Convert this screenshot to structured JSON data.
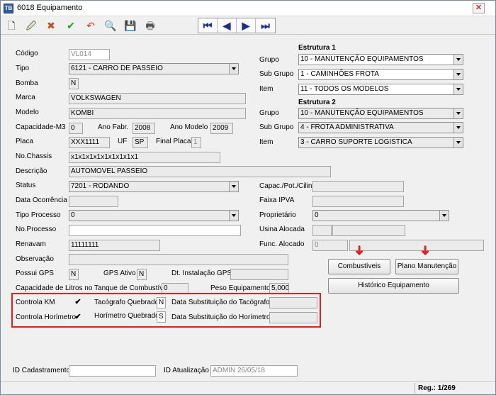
{
  "window": {
    "title": "6018 Equipamento",
    "app_icon_text": "TB",
    "close_glyph": "✕"
  },
  "toolbar": {
    "icons": [
      "new-icon",
      "edit-icon",
      "delete-icon",
      "confirm-icon",
      "undo-icon",
      "search-icon",
      "save-icon",
      "print-icon"
    ],
    "glyphs": [
      "🗋",
      "🖉",
      "✖",
      "✔",
      "↶",
      "🔍",
      "💾",
      "🖶"
    ],
    "nav": [
      "⏮",
      "◀",
      "▶",
      "⏭"
    ]
  },
  "fields": {
    "codigo": {
      "label": "Código",
      "value": "VL014"
    },
    "tipo": {
      "label": "Tipo",
      "value": "6121 - CARRO DE PASSEIO"
    },
    "bomba": {
      "label": "Bomba",
      "value": "N"
    },
    "marca": {
      "label": "Marca",
      "value": "VOLKSWAGEN"
    },
    "modelo": {
      "label": "Modelo",
      "value": "KOMBI"
    },
    "capacidade": {
      "label": "Capacidade-M3",
      "value": "0"
    },
    "ano_fabr": {
      "label": "Ano Fabr.",
      "value": "2008"
    },
    "ano_modelo": {
      "label": "Ano Modelo",
      "value": "2009"
    },
    "placa": {
      "label": "Placa",
      "value": "XXX1111"
    },
    "uf": {
      "label": "UF",
      "value": "SP"
    },
    "final_placa": {
      "label": "Final Placa",
      "value": "1"
    },
    "chassis": {
      "label": "No.Chassis",
      "value": "x1x1x1x1x1x1x1x1x1"
    },
    "descricao": {
      "label": "Descrição",
      "value": "AUTOMOVEL PASSEIO"
    },
    "status": {
      "label": "Status",
      "value": "7201 - RODANDO"
    },
    "data_ocorrencia": {
      "label": "Data Ocorrência",
      "value": ""
    },
    "tipo_processo": {
      "label": "Tipo Processo",
      "value": "0"
    },
    "no_processo": {
      "label": "No.Processo",
      "value": ""
    },
    "renavam": {
      "label": "Renavam",
      "value": "11111111"
    },
    "observacao": {
      "label": "Observação",
      "value": ""
    },
    "possui_gps": {
      "label": "Possui GPS",
      "value": "N"
    },
    "gps_ativo": {
      "label": "GPS Ativo",
      "value": "N"
    },
    "dt_instalacao_gps": {
      "label": "Dt. Instalação GPS",
      "value": ""
    },
    "capacidade_litros": {
      "label": "Capacidade de Litros no Tanque de Combustível",
      "value": "0"
    },
    "peso": {
      "label": "Peso Equipamento",
      "value": "5,000"
    },
    "capac_pot": {
      "label": "Capac./Pot./Cilin.",
      "value": ""
    },
    "faixa_ipva": {
      "label": "Faixa IPVA",
      "value": ""
    },
    "proprietario": {
      "label": "Proprietário",
      "value": "0"
    },
    "usina_alocada": {
      "label": "Usina Alocada",
      "value": ""
    },
    "func_alocado": {
      "label": "Func. Alocado",
      "value": "0"
    }
  },
  "estrutura1": {
    "heading": "Estrutura 1",
    "grupo": {
      "label": "Grupo",
      "value": "10 - MANUTENÇÃO EQUIPAMENTOS"
    },
    "sub_grupo": {
      "label": "Sub Grupo",
      "value": "1 - CAMINHÕES FROTA"
    },
    "item": {
      "label": "Item",
      "value": "11 - TODOS OS MODELOS"
    }
  },
  "estrutura2": {
    "heading": "Estrutura 2",
    "grupo": {
      "label": "Grupo",
      "value": "10 - MANUTENÇÃO EQUIPAMENTOS"
    },
    "sub_grupo": {
      "label": "Sub Grupo",
      "value": "4 - FROTA ADMINISTRATIVA"
    },
    "item": {
      "label": "Item",
      "value": "3 - CARRO SUPORTE LOGISTICA"
    }
  },
  "buttons": {
    "combustiveis": "Combustíveis",
    "plano_manutencao": "Plano Manutenção",
    "historico": "Histórico Equipamento"
  },
  "controls": {
    "controla_km": {
      "label": "Controla KM",
      "checked": "✔"
    },
    "controla_horimetro": {
      "label": "Controla Horímetro",
      "checked": "✔"
    },
    "tacografo_quebrado": {
      "label": "Tacógrafo Quebrado",
      "value": "N"
    },
    "horimetro_quebrado": {
      "label": "Horímetro Quebrado",
      "value": "S"
    },
    "data_subst_tacografo": {
      "label": "Data Substituição do Tacógrafo",
      "value": ""
    },
    "data_subst_horimetro": {
      "label": "Data Substituição do Horímetro",
      "value": ""
    }
  },
  "footer": {
    "id_cadastramento": {
      "label": "ID Cadastramento",
      "value": ""
    },
    "id_atualizacao": {
      "label": "ID Atualização",
      "value": "ADMIN 26/05/18"
    }
  },
  "annotations": {
    "arrow_glyph": "➜",
    "accent_color": "#e02020"
  },
  "status": {
    "record": "Reg.: 1/269"
  }
}
